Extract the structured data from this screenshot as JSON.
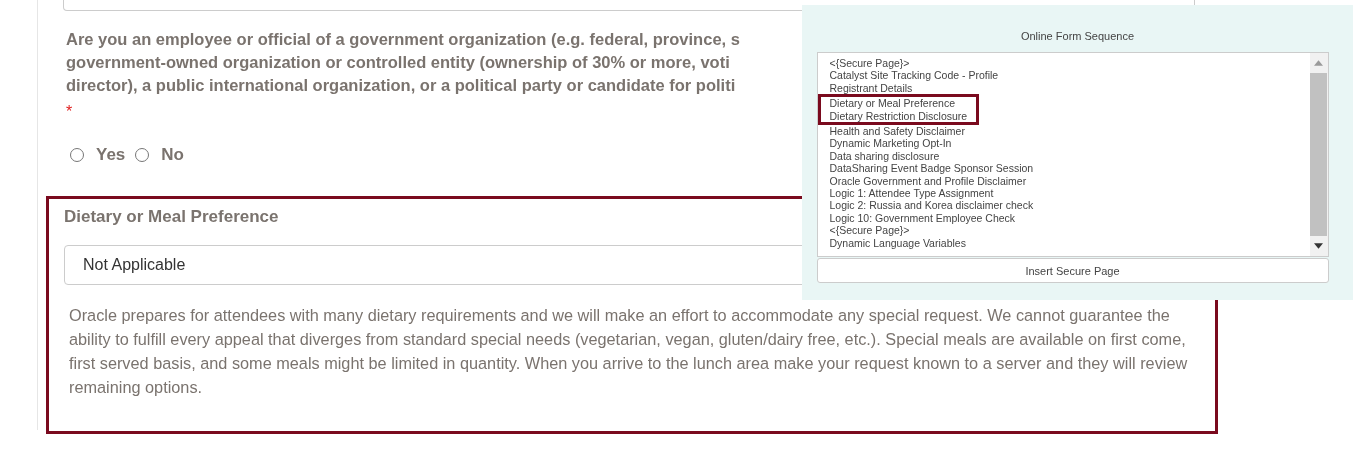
{
  "question": {
    "lines": [
      "Are you an employee or official of a government organization (e.g. federal, province, s",
      "government-owned organization or controlled entity (ownership of 30% or more, voti",
      "director), a public international organization, or a political party or candidate for politi"
    ],
    "required_mark": "*",
    "options": [
      {
        "label": "Yes",
        "selected": false
      },
      {
        "label": "No",
        "selected": false
      }
    ]
  },
  "dietary": {
    "title": "Dietary or Meal Preference",
    "value": "Not Applicable",
    "description": "Oracle prepares for attendees with many dietary requirements and we will make an effort to accommodate any special request. We cannot guarantee the ability to fulfill every appeal that diverges from standard special needs (vegetarian, vegan, gluten/dairy free, etc.). Special meals are available on first come, first served basis, and some meals might be limited in quantity. When you arrive to the lunch area make your request known to a server and they will review remaining options."
  },
  "sequence": {
    "title": "Online Form Sequence",
    "items": [
      {
        "label": "<{Secure Page}>",
        "highlighted": false
      },
      {
        "label": "Catalyst Site Tracking Code - Profile",
        "highlighted": false
      },
      {
        "label": "Registrant Details",
        "highlighted": false
      },
      {
        "label": "Dietary or Meal Preference",
        "highlighted": true
      },
      {
        "label": "Dietary Restriction Disclosure",
        "highlighted": true
      },
      {
        "label": "Health and Safety Disclaimer",
        "highlighted": false
      },
      {
        "label": "Dynamic Marketing Opt-In",
        "highlighted": false
      },
      {
        "label": "Data sharing disclosure",
        "highlighted": false
      },
      {
        "label": "DataSharing Event Badge Sponsor Session",
        "highlighted": false
      },
      {
        "label": "Oracle Government and Profile Disclaimer",
        "highlighted": false
      },
      {
        "label": "Logic 1: Attendee Type Assignment",
        "highlighted": false
      },
      {
        "label": "Logic 2: Russia and Korea disclaimer check",
        "highlighted": false
      },
      {
        "label": "Logic 10: Government Employee Check",
        "highlighted": false
      },
      {
        "label": "<{Secure Page}>",
        "highlighted": false
      },
      {
        "label": "Dynamic Language Variables",
        "highlighted": false
      }
    ],
    "button": "Insert Secure Page"
  }
}
